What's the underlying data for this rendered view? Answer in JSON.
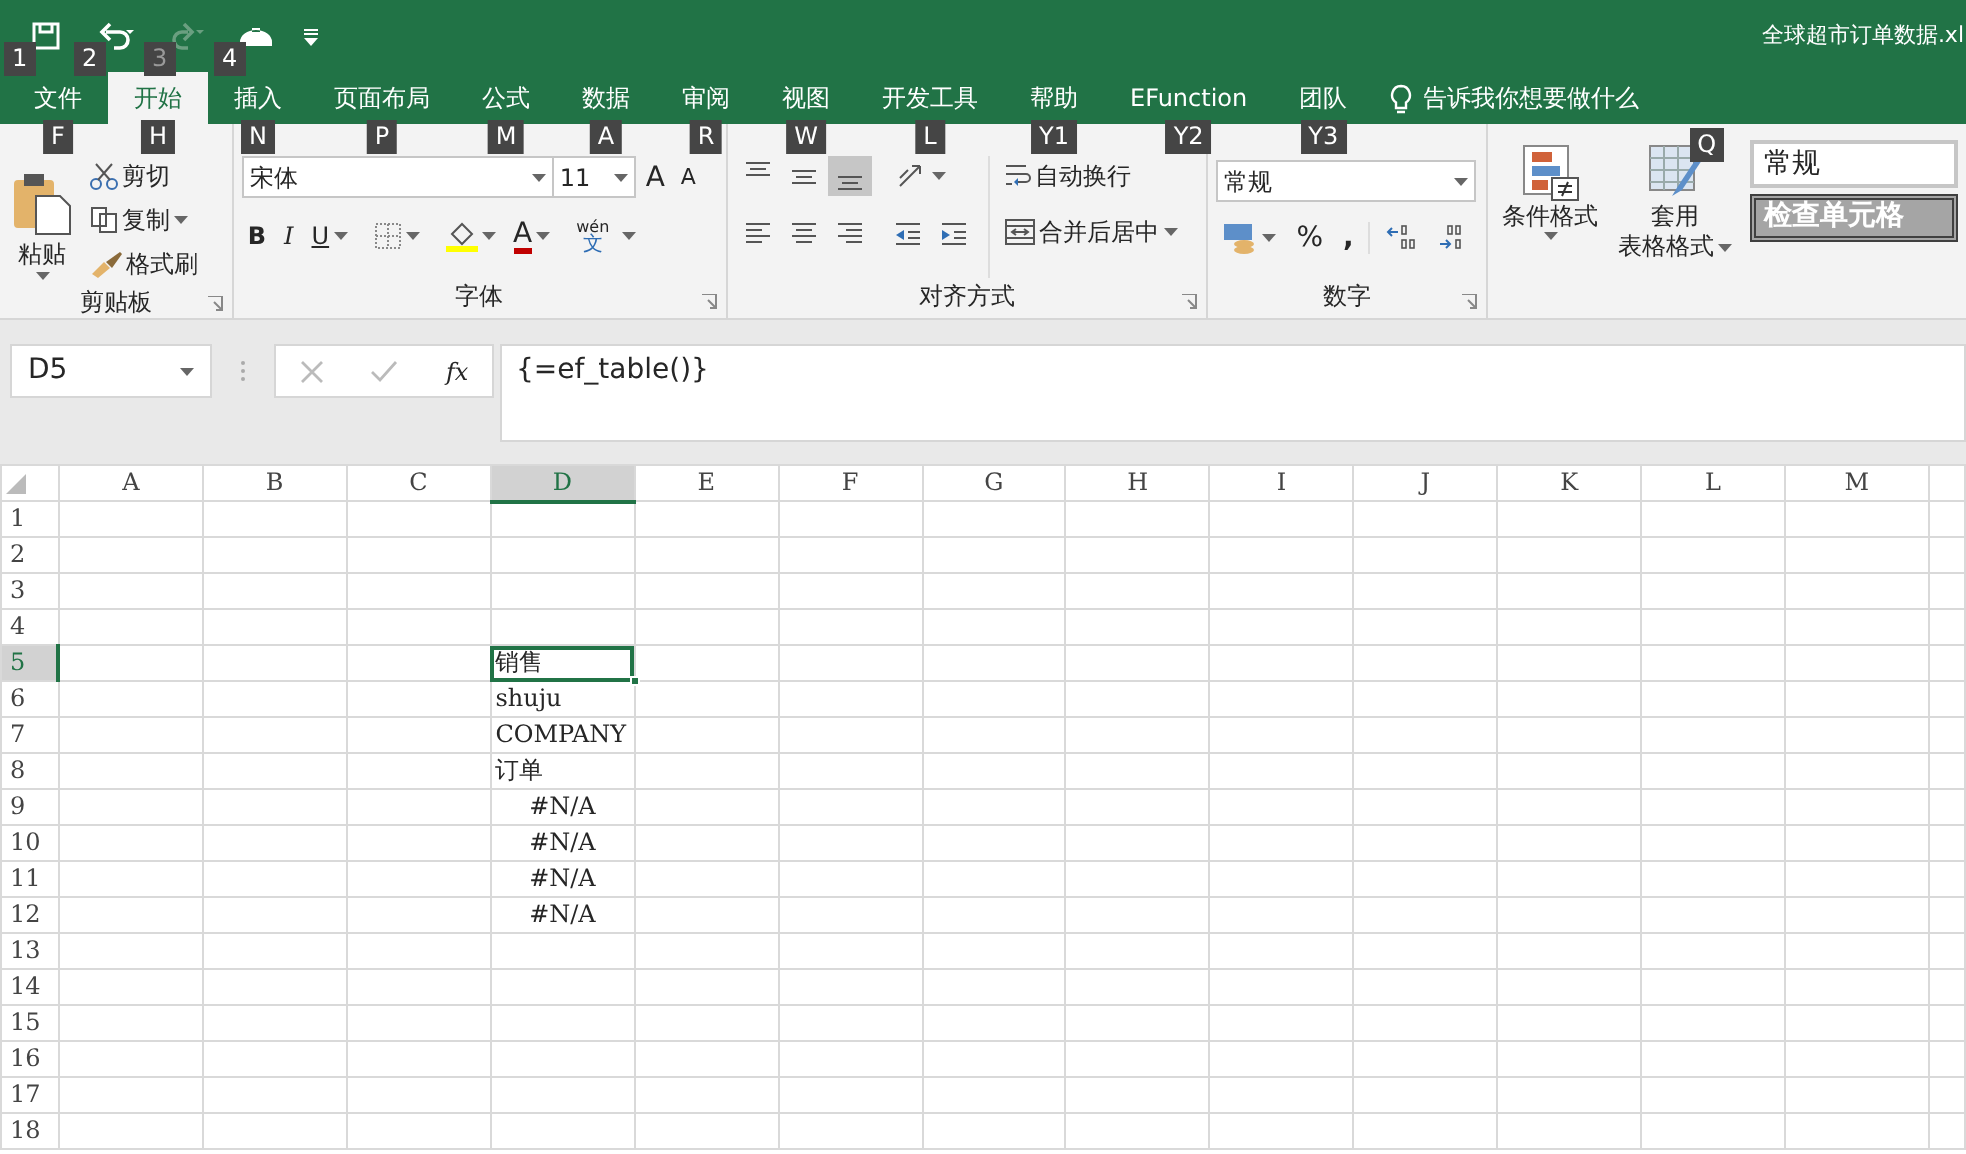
{
  "title_bar": {
    "quick_access": [
      {
        "kind": "save",
        "keytip": "1",
        "disabled": false
      },
      {
        "kind": "undo",
        "keytip": "2",
        "disabled": false
      },
      {
        "kind": "redo",
        "keytip": "3",
        "disabled": true
      },
      {
        "kind": "touch",
        "keytip": "4",
        "disabled": false
      }
    ],
    "title": "全球超市订单数据.xl"
  },
  "tabs": [
    {
      "label": "文件",
      "keytip": "F",
      "selected": false
    },
    {
      "label": "开始",
      "keytip": "H",
      "selected": true
    },
    {
      "label": "插入",
      "keytip": "N",
      "selected": false
    },
    {
      "label": "页面布局",
      "keytip": "P",
      "selected": false
    },
    {
      "label": "公式",
      "keytip": "M",
      "selected": false
    },
    {
      "label": "数据",
      "keytip": "A",
      "selected": false
    },
    {
      "label": "审阅",
      "keytip": "R",
      "selected": false
    },
    {
      "label": "视图",
      "keytip": "W",
      "selected": false
    },
    {
      "label": "开发工具",
      "keytip": "L",
      "selected": false
    },
    {
      "label": "帮助",
      "keytip": "Y1",
      "selected": false
    },
    {
      "label": "EFunction",
      "keytip": "Y2",
      "selected": false
    },
    {
      "label": "团队",
      "keytip": "Y3",
      "selected": false
    }
  ],
  "tell_me": {
    "placeholder": "告诉我你想要做什么",
    "keytip": "Q"
  },
  "ribbon": {
    "clipboard": {
      "paste": "粘贴",
      "cut": "剪切",
      "copy": "复制",
      "format_painter": "格式刷",
      "label": "剪贴板"
    },
    "font": {
      "name": "宋体",
      "size": "11",
      "grow": "A",
      "shrink": "A",
      "bold": "B",
      "italic": "I",
      "underline": "U",
      "font_color": "A",
      "phonetic_top": "wén",
      "phonetic_bottom": "文",
      "label": "字体"
    },
    "alignment": {
      "vertical": [
        {
          "selected": false
        },
        {
          "selected": false
        },
        {
          "selected": true
        }
      ],
      "wrap": "自动换行",
      "merge": "合并后居中",
      "label": "对齐方式"
    },
    "number": {
      "format": "常规",
      "percent": "%",
      "comma": ",",
      "label": "数字"
    },
    "styles": {
      "conditional": "条件格式",
      "table_top": "套用",
      "table_bottom": "表格格式",
      "normal": "常规",
      "check_cell": "检查单元格"
    }
  },
  "formula_bar": {
    "name_box": "D5",
    "fx": "fx",
    "formula": "{=ef_table()}"
  },
  "sheet": {
    "columns": [
      {
        "label": "A",
        "selected": false
      },
      {
        "label": "B",
        "selected": false
      },
      {
        "label": "C",
        "selected": false
      },
      {
        "label": "D",
        "selected": true
      },
      {
        "label": "E",
        "selected": false
      },
      {
        "label": "F",
        "selected": false
      },
      {
        "label": "G",
        "selected": false
      },
      {
        "label": "H",
        "selected": false
      },
      {
        "label": "I",
        "selected": false
      },
      {
        "label": "J",
        "selected": false
      },
      {
        "label": "K",
        "selected": false
      },
      {
        "label": "L",
        "selected": false
      },
      {
        "label": "M",
        "selected": false
      }
    ],
    "rows": [
      {
        "label": "1",
        "selected": false
      },
      {
        "label": "2",
        "selected": false
      },
      {
        "label": "3",
        "selected": false
      },
      {
        "label": "4",
        "selected": false
      },
      {
        "label": "5",
        "selected": true,
        "cells": [
          null,
          null,
          null,
          {
            "text": "销售",
            "selected": true,
            "kind": "text"
          }
        ]
      },
      {
        "label": "6",
        "selected": false,
        "cells": [
          null,
          null,
          null,
          {
            "text": "shuju",
            "selected": false,
            "kind": "text"
          }
        ]
      },
      {
        "label": "7",
        "selected": false,
        "cells": [
          null,
          null,
          null,
          {
            "text": "COMPANY",
            "selected": false,
            "kind": "text"
          }
        ]
      },
      {
        "label": "8",
        "selected": false,
        "cells": [
          null,
          null,
          null,
          {
            "text": "订单",
            "selected": false,
            "kind": "text"
          }
        ]
      },
      {
        "label": "9",
        "selected": false,
        "cells": [
          null,
          null,
          null,
          {
            "text": "#N/A",
            "selected": false,
            "kind": "error"
          }
        ]
      },
      {
        "label": "10",
        "selected": false,
        "cells": [
          null,
          null,
          null,
          {
            "text": "#N/A",
            "selected": false,
            "kind": "error"
          }
        ]
      },
      {
        "label": "11",
        "selected": false,
        "cells": [
          null,
          null,
          null,
          {
            "text": "#N/A",
            "selected": false,
            "kind": "error"
          }
        ]
      },
      {
        "label": "12",
        "selected": false,
        "cells": [
          null,
          null,
          null,
          {
            "text": "#N/A",
            "selected": false,
            "kind": "error"
          }
        ]
      },
      {
        "label": "13",
        "selected": false
      },
      {
        "label": "14",
        "selected": false
      },
      {
        "label": "15",
        "selected": false
      },
      {
        "label": "16",
        "selected": false
      },
      {
        "label": "17",
        "selected": false
      },
      {
        "label": "18",
        "selected": false
      }
    ]
  }
}
